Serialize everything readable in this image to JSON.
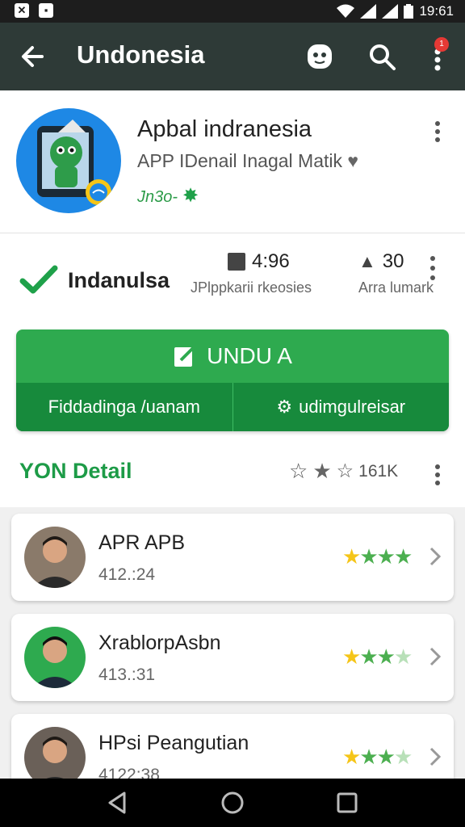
{
  "status_bar": {
    "left_icons": [
      "notification-x-icon",
      "notification-app-icon"
    ],
    "time": "19:61",
    "right_icons": [
      "wifi-icon",
      "signal-icon",
      "signal-icon-2",
      "battery-icon"
    ]
  },
  "app_bar": {
    "title": "Undonesia",
    "badge": "1"
  },
  "app": {
    "name": "Apbal indranesia",
    "developer": "APP IDenail Inagal Matik",
    "tag": "Jn3o-"
  },
  "stats": {
    "verified_label": "Indanulsa",
    "stat1_value": "4:96",
    "stat1_label": "JPlppkarii rkeosies",
    "stat2_value": "30",
    "stat2_label": "Arra lumark"
  },
  "install": {
    "main_label": "UNDU A",
    "left_label": "Fiddadinga /uanam",
    "right_label": "udimgulreisar"
  },
  "section": {
    "title": "YON Detail",
    "right_text": "161K"
  },
  "reviews": [
    {
      "name": "APR APB",
      "sub": "412.:24",
      "rating": 4,
      "avatar_bg": "#8a7a6a"
    },
    {
      "name": "XrablorpAsbn",
      "sub": "413.:31",
      "rating": 3.5,
      "avatar_bg": "#2eaa4f"
    },
    {
      "name": "HPsi Peangutian",
      "sub": "4122:38",
      "rating": 3.5,
      "avatar_bg": "#6a6058"
    }
  ],
  "colors": {
    "app_bar": "#2e3a37",
    "accent_green": "#2eaa4f",
    "dark_green": "#178a3c",
    "star_yellow": "#f5c518"
  }
}
